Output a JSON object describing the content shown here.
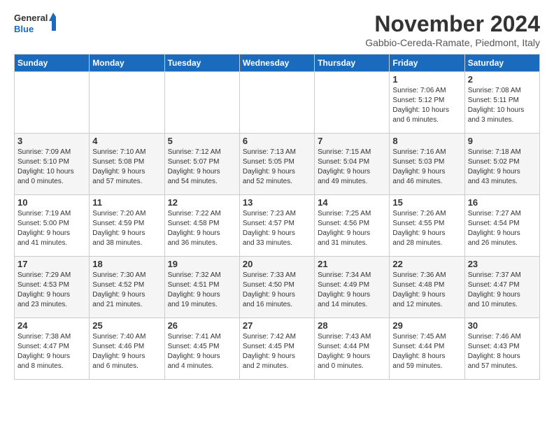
{
  "logo": {
    "general": "General",
    "blue": "Blue"
  },
  "title": "November 2024",
  "subtitle": "Gabbio-Cereda-Ramate, Piedmont, Italy",
  "days_of_week": [
    "Sunday",
    "Monday",
    "Tuesday",
    "Wednesday",
    "Thursday",
    "Friday",
    "Saturday"
  ],
  "weeks": [
    [
      {
        "day": "",
        "info": ""
      },
      {
        "day": "",
        "info": ""
      },
      {
        "day": "",
        "info": ""
      },
      {
        "day": "",
        "info": ""
      },
      {
        "day": "",
        "info": ""
      },
      {
        "day": "1",
        "info": "Sunrise: 7:06 AM\nSunset: 5:12 PM\nDaylight: 10 hours\nand 6 minutes."
      },
      {
        "day": "2",
        "info": "Sunrise: 7:08 AM\nSunset: 5:11 PM\nDaylight: 10 hours\nand 3 minutes."
      }
    ],
    [
      {
        "day": "3",
        "info": "Sunrise: 7:09 AM\nSunset: 5:10 PM\nDaylight: 10 hours\nand 0 minutes."
      },
      {
        "day": "4",
        "info": "Sunrise: 7:10 AM\nSunset: 5:08 PM\nDaylight: 9 hours\nand 57 minutes."
      },
      {
        "day": "5",
        "info": "Sunrise: 7:12 AM\nSunset: 5:07 PM\nDaylight: 9 hours\nand 54 minutes."
      },
      {
        "day": "6",
        "info": "Sunrise: 7:13 AM\nSunset: 5:05 PM\nDaylight: 9 hours\nand 52 minutes."
      },
      {
        "day": "7",
        "info": "Sunrise: 7:15 AM\nSunset: 5:04 PM\nDaylight: 9 hours\nand 49 minutes."
      },
      {
        "day": "8",
        "info": "Sunrise: 7:16 AM\nSunset: 5:03 PM\nDaylight: 9 hours\nand 46 minutes."
      },
      {
        "day": "9",
        "info": "Sunrise: 7:18 AM\nSunset: 5:02 PM\nDaylight: 9 hours\nand 43 minutes."
      }
    ],
    [
      {
        "day": "10",
        "info": "Sunrise: 7:19 AM\nSunset: 5:00 PM\nDaylight: 9 hours\nand 41 minutes."
      },
      {
        "day": "11",
        "info": "Sunrise: 7:20 AM\nSunset: 4:59 PM\nDaylight: 9 hours\nand 38 minutes."
      },
      {
        "day": "12",
        "info": "Sunrise: 7:22 AM\nSunset: 4:58 PM\nDaylight: 9 hours\nand 36 minutes."
      },
      {
        "day": "13",
        "info": "Sunrise: 7:23 AM\nSunset: 4:57 PM\nDaylight: 9 hours\nand 33 minutes."
      },
      {
        "day": "14",
        "info": "Sunrise: 7:25 AM\nSunset: 4:56 PM\nDaylight: 9 hours\nand 31 minutes."
      },
      {
        "day": "15",
        "info": "Sunrise: 7:26 AM\nSunset: 4:55 PM\nDaylight: 9 hours\nand 28 minutes."
      },
      {
        "day": "16",
        "info": "Sunrise: 7:27 AM\nSunset: 4:54 PM\nDaylight: 9 hours\nand 26 minutes."
      }
    ],
    [
      {
        "day": "17",
        "info": "Sunrise: 7:29 AM\nSunset: 4:53 PM\nDaylight: 9 hours\nand 23 minutes."
      },
      {
        "day": "18",
        "info": "Sunrise: 7:30 AM\nSunset: 4:52 PM\nDaylight: 9 hours\nand 21 minutes."
      },
      {
        "day": "19",
        "info": "Sunrise: 7:32 AM\nSunset: 4:51 PM\nDaylight: 9 hours\nand 19 minutes."
      },
      {
        "day": "20",
        "info": "Sunrise: 7:33 AM\nSunset: 4:50 PM\nDaylight: 9 hours\nand 16 minutes."
      },
      {
        "day": "21",
        "info": "Sunrise: 7:34 AM\nSunset: 4:49 PM\nDaylight: 9 hours\nand 14 minutes."
      },
      {
        "day": "22",
        "info": "Sunrise: 7:36 AM\nSunset: 4:48 PM\nDaylight: 9 hours\nand 12 minutes."
      },
      {
        "day": "23",
        "info": "Sunrise: 7:37 AM\nSunset: 4:47 PM\nDaylight: 9 hours\nand 10 minutes."
      }
    ],
    [
      {
        "day": "24",
        "info": "Sunrise: 7:38 AM\nSunset: 4:47 PM\nDaylight: 9 hours\nand 8 minutes."
      },
      {
        "day": "25",
        "info": "Sunrise: 7:40 AM\nSunset: 4:46 PM\nDaylight: 9 hours\nand 6 minutes."
      },
      {
        "day": "26",
        "info": "Sunrise: 7:41 AM\nSunset: 4:45 PM\nDaylight: 9 hours\nand 4 minutes."
      },
      {
        "day": "27",
        "info": "Sunrise: 7:42 AM\nSunset: 4:45 PM\nDaylight: 9 hours\nand 2 minutes."
      },
      {
        "day": "28",
        "info": "Sunrise: 7:43 AM\nSunset: 4:44 PM\nDaylight: 9 hours\nand 0 minutes."
      },
      {
        "day": "29",
        "info": "Sunrise: 7:45 AM\nSunset: 4:44 PM\nDaylight: 8 hours\nand 59 minutes."
      },
      {
        "day": "30",
        "info": "Sunrise: 7:46 AM\nSunset: 4:43 PM\nDaylight: 8 hours\nand 57 minutes."
      }
    ]
  ]
}
